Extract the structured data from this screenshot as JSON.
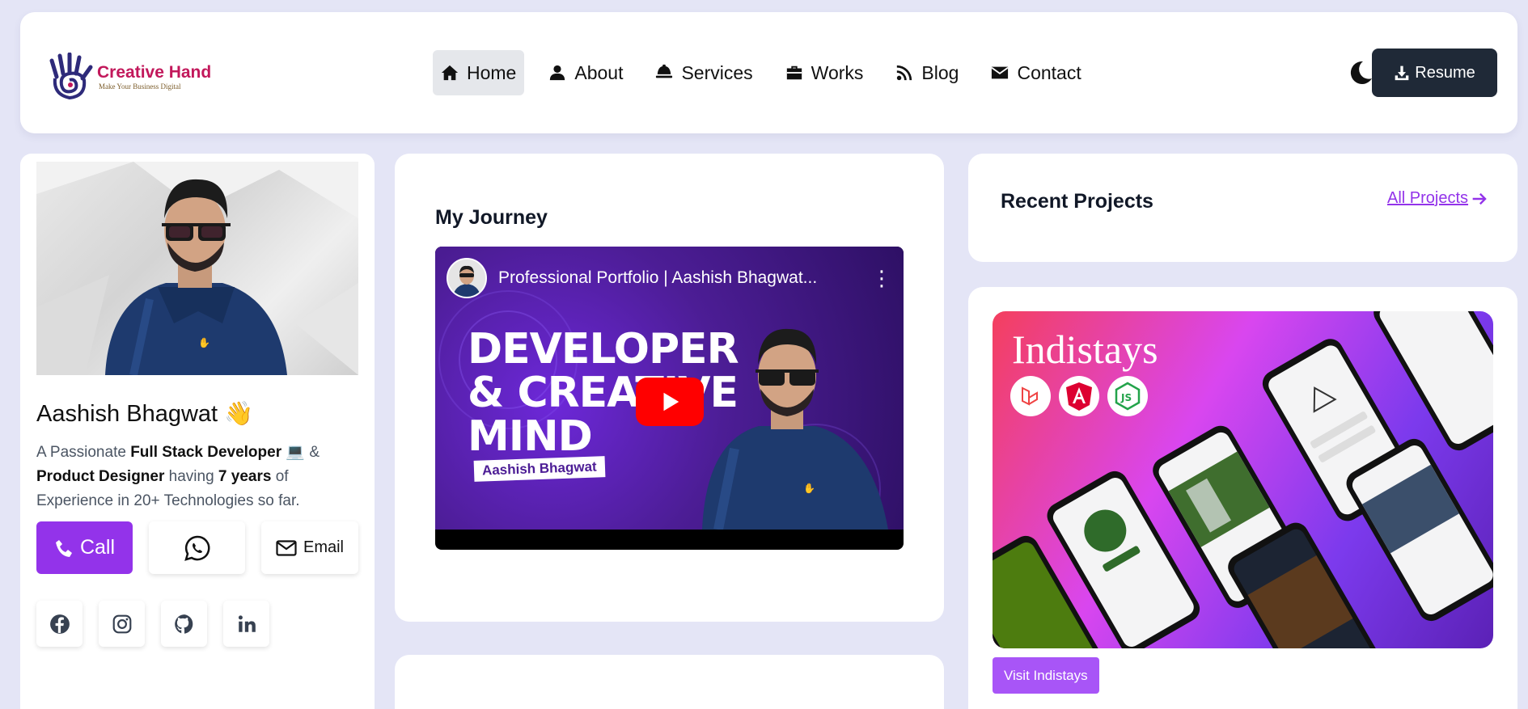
{
  "header": {
    "logo": {
      "title": "Creative Hand",
      "tagline": "Make Your Business Digital"
    },
    "nav": [
      {
        "label": "Home",
        "icon": "home-icon",
        "active": true
      },
      {
        "label": "About",
        "icon": "user-icon",
        "active": false
      },
      {
        "label": "Services",
        "icon": "bell-icon",
        "active": false
      },
      {
        "label": "Works",
        "icon": "briefcase-icon",
        "active": false
      },
      {
        "label": "Blog",
        "icon": "rss-icon",
        "active": false
      },
      {
        "label": "Contact",
        "icon": "envelope-icon",
        "active": false
      }
    ],
    "theme_toggle_icon": "moon-icon",
    "resume_label": "Resume"
  },
  "profile": {
    "name": "Aashish Bhagwat",
    "wave_emoji": "👋",
    "bio": {
      "p1": "A Passionate ",
      "b1": "Full Stack Developer",
      "computer_emoji": "💻",
      "p2": " & ",
      "b2": "Product Designer",
      "p3": " having ",
      "b3": "7 years",
      "p4": " of Experience in 20+ Technologies so far."
    },
    "call_label": "Call",
    "email_label": "Email"
  },
  "journey": {
    "title": "My Journey",
    "video": {
      "title": "Professional Portfolio | Aashish Bhagwat...",
      "headline_1": "DEVELOPER",
      "headline_2": "& CREATIVE",
      "headline_3": "MIND",
      "name_tag": "Aashish Bhagwat"
    }
  },
  "recent": {
    "title": "Recent Projects",
    "all_link": "All Projects"
  },
  "project": {
    "name": "Indistays",
    "visit_label": "Visit Indistays"
  },
  "colors": {
    "accent": "#9333ea",
    "dark": "#1f2937",
    "background": "#e4e5f6"
  }
}
